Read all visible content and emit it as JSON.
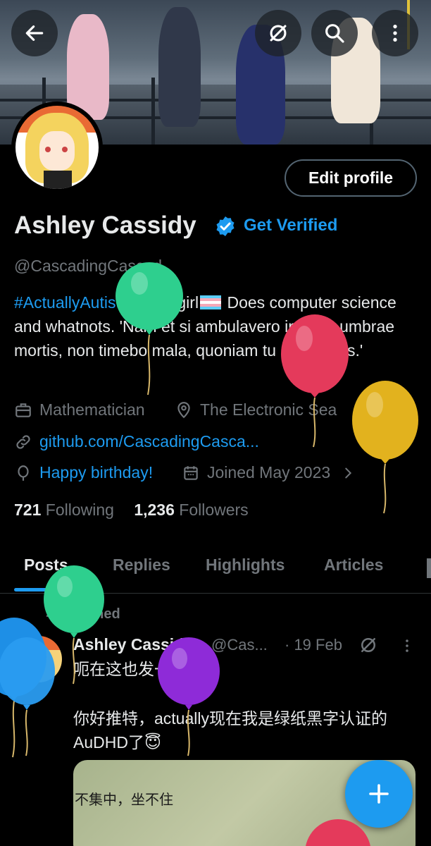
{
  "profile": {
    "name": "Ashley Cassidy",
    "get_verified": "Get Verified",
    "handle": "@CascadingCascad",
    "edit_label": "Edit profile",
    "bio_tag": "#ActuallyAutistic",
    "bio_part1": " trans girl",
    "bio_part2": " Does computer science and whatnots.  'Nam et si ambulavero in valle umbrae mortis, non timebo mala, quoniam tu mecum es.'",
    "profession": "Mathematician",
    "location": "The Electronic Sea",
    "website": "github.com/CascadingCasca...",
    "birthday": "Happy birthday!",
    "joined": "Joined May 2023",
    "following_count": "721",
    "following_label": "Following",
    "followers_count": "1,236",
    "followers_label": "Followers"
  },
  "tabs": [
    "Posts",
    "Replies",
    "Highlights",
    "Articles"
  ],
  "post": {
    "pinned_label": "Pinned",
    "author": "Ashley Cassidy",
    "handle": "@Cas...",
    "date": "· 19 Feb",
    "line1": "呃在这也发一下好了",
    "line2": "你好推特，actually现在我是绿纸黑字认证的AuDHD了😇",
    "image_text": "不集中，坐不住"
  },
  "icons": {
    "back": "arrow-left-icon",
    "mute": "no-eye-icon",
    "search": "search-icon",
    "more": "more-vertical-icon",
    "compose": "plus-icon"
  },
  "colors": {
    "accent": "#1d9bf0",
    "muted": "#71767b",
    "text": "#e7e9ea"
  }
}
